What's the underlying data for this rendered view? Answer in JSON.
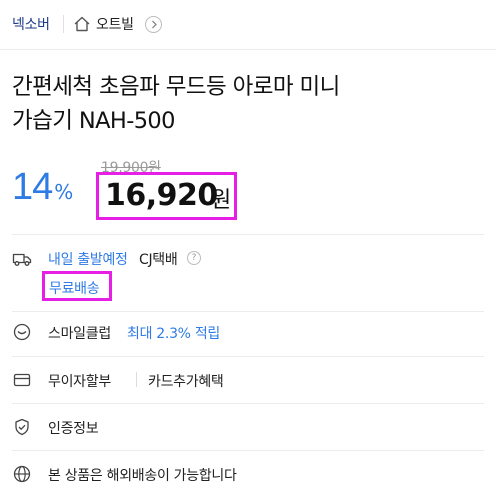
{
  "header": {
    "brand": "넥소버",
    "breadcrumb": "오트빌"
  },
  "product": {
    "title_line1": "간편세척 초음파 무드등 아로마 미니",
    "title_line2": "가습기 NAH-500",
    "discount_value": "14",
    "discount_unit": "%",
    "original_price": "19,900원",
    "sale_price": "16,920",
    "sale_price_unit": "원"
  },
  "delivery": {
    "eta": "내일 출발예정",
    "carrier": "CJ택배",
    "help": "?",
    "shipping_fee": "무료배송"
  },
  "benefits": {
    "smile_club_label": "스마일클럽",
    "smile_club_reward": "최대 2.3% 적립",
    "installment": "무이자할부",
    "card_benefit": "카드추가혜택",
    "certification": "인증정보",
    "overseas_shipping": "본 상품은 해외배송이 가능합니다"
  },
  "colors": {
    "accent_blue": "#2f7be6",
    "highlight_magenta": "#e61ee6",
    "brand_navy": "#1e3a8a"
  }
}
